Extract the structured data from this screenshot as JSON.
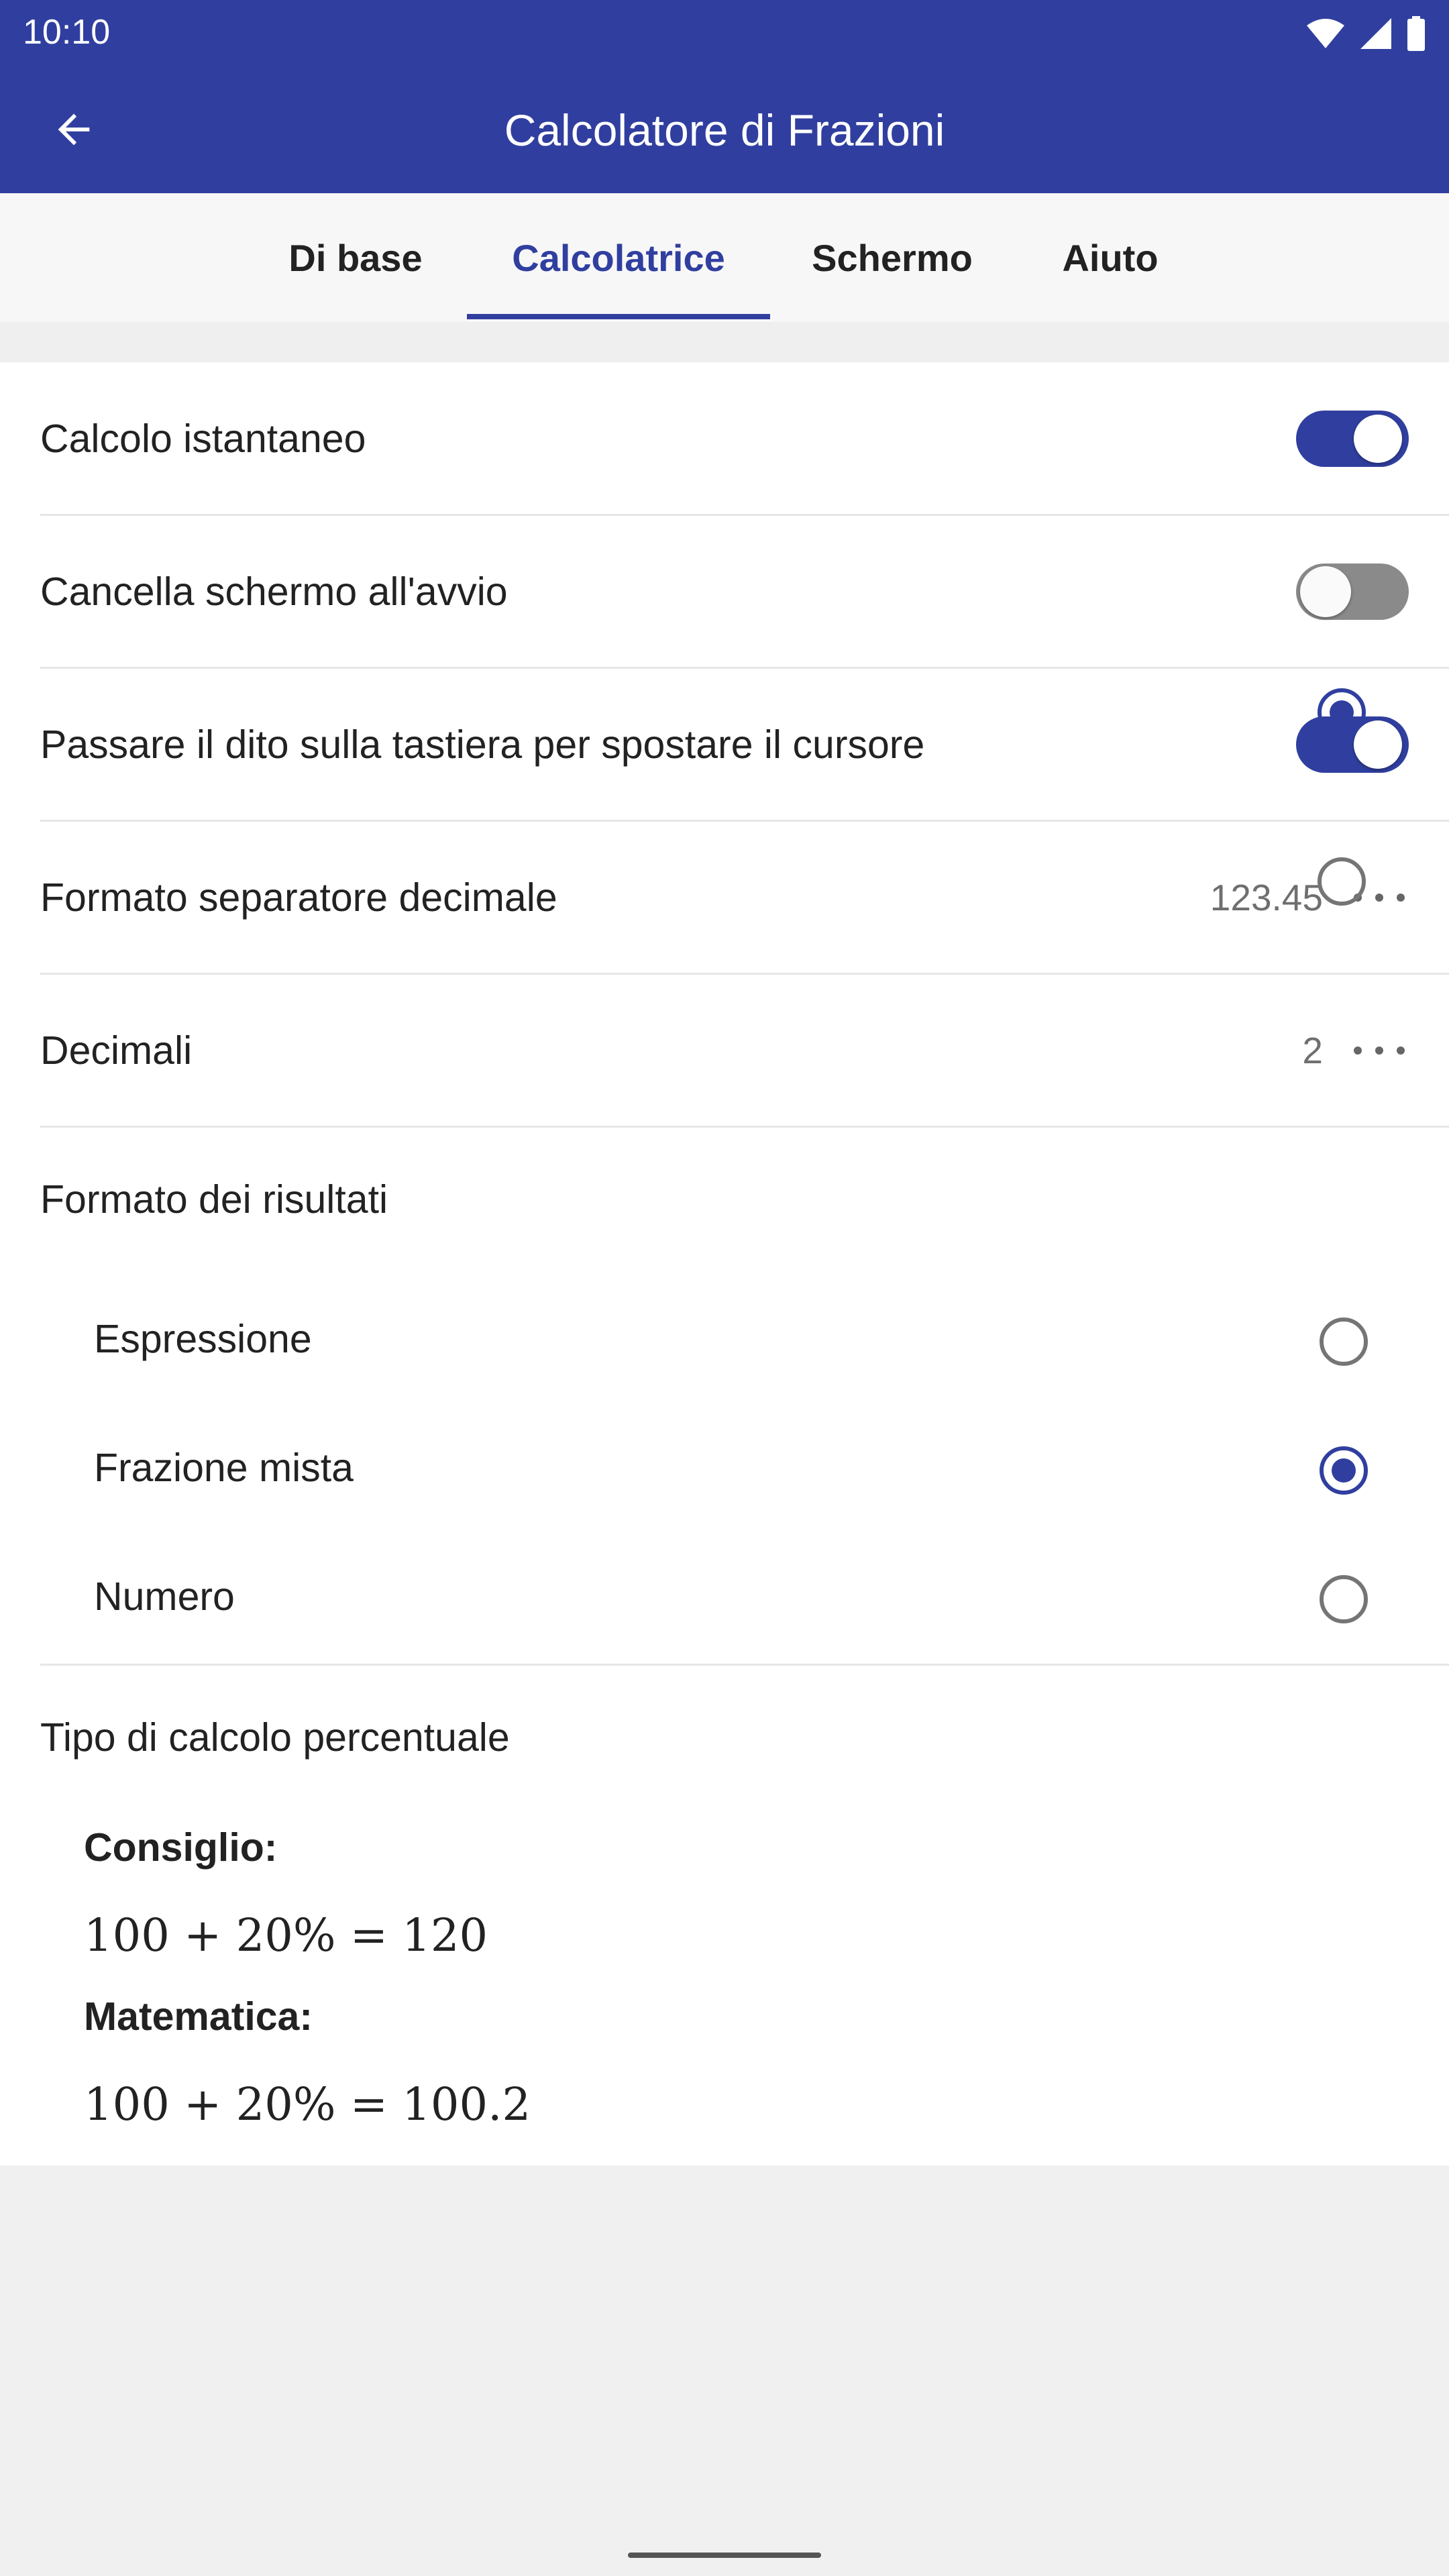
{
  "status_bar": {
    "time": "10:10",
    "icons": [
      "wifi-icon",
      "signal-icon",
      "battery-icon"
    ]
  },
  "app_bar": {
    "title": "Calcolatore di Frazioni",
    "back_icon": "arrow-back-icon"
  },
  "tabs": [
    {
      "label": "Di base",
      "active": false
    },
    {
      "label": "Calcolatrice",
      "active": true
    },
    {
      "label": "Schermo",
      "active": false
    },
    {
      "label": "Aiuto",
      "active": false
    }
  ],
  "settings": {
    "instant_calc": {
      "label": "Calcolo istantaneo",
      "enabled": true
    },
    "clear_on_start": {
      "label": "Cancella schermo all'avvio",
      "enabled": false
    },
    "swipe_cursor": {
      "label": "Passare il dito sulla tastiera per spostare il cursore",
      "enabled": true
    },
    "decimal_separator": {
      "label": "Formato separatore decimale",
      "value": "123.45"
    },
    "decimals": {
      "label": "Decimali",
      "value": "2"
    }
  },
  "result_format": {
    "title": "Formato dei risultati",
    "options": [
      {
        "label": "Espressione",
        "selected": false
      },
      {
        "label": "Frazione mista",
        "selected": true
      },
      {
        "label": "Numero",
        "selected": false
      }
    ]
  },
  "percent_calc": {
    "title": "Tipo di calcolo percentuale",
    "options": [
      {
        "label": "Consiglio:",
        "formula": "100 + 20% = 120",
        "selected": true
      },
      {
        "label": "Matematica:",
        "formula": "100 + 20% = 100.2",
        "selected": false
      }
    ]
  },
  "colors": {
    "primary": "#303f9f",
    "background": "#f0f0f0",
    "surface": "#ffffff"
  }
}
